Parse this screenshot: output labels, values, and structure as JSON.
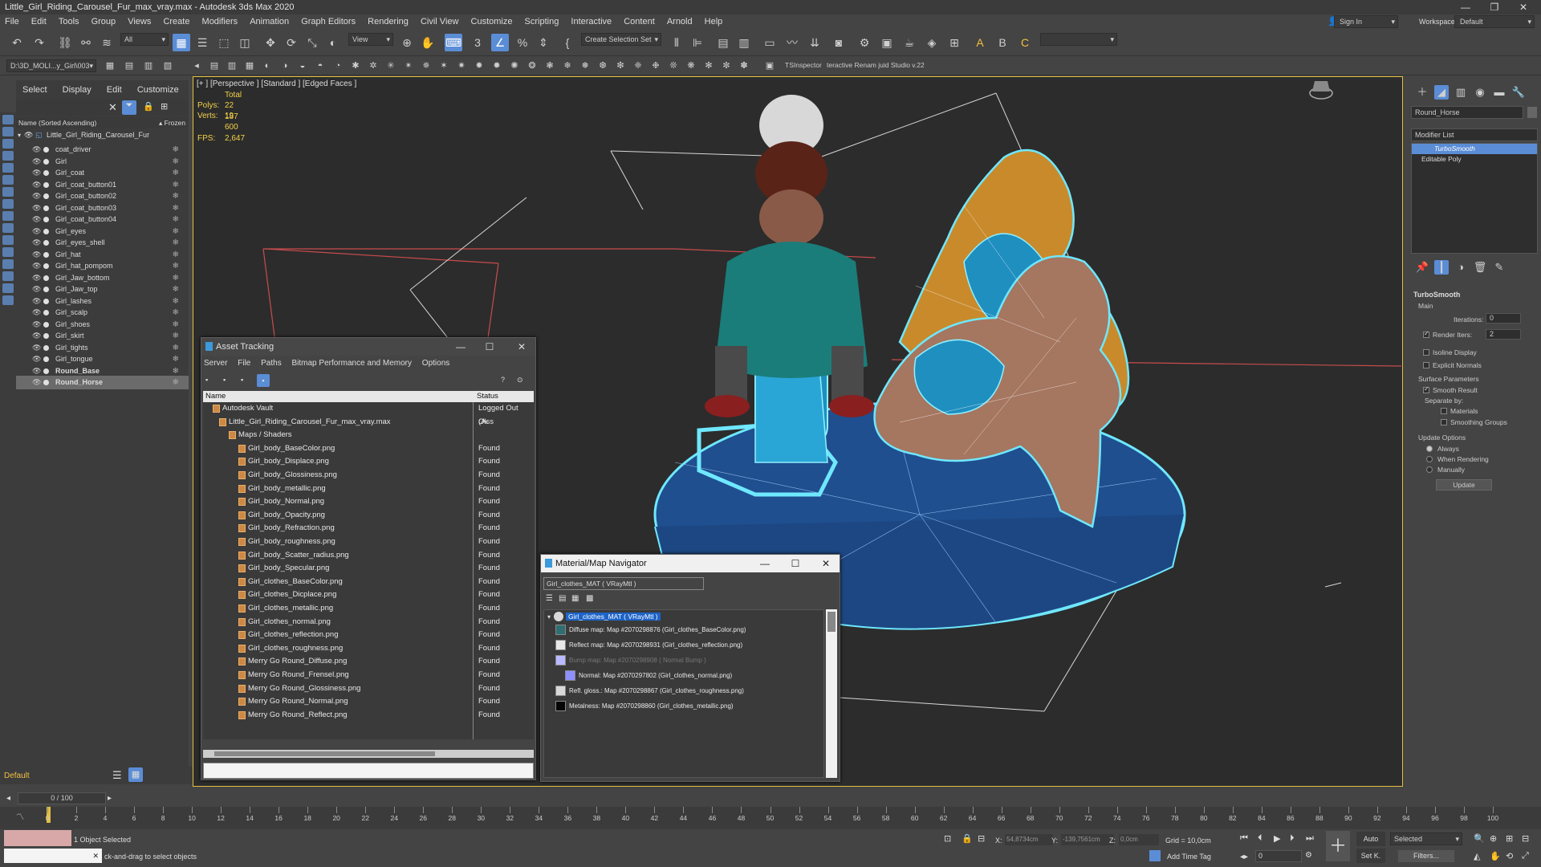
{
  "title": "Little_Girl_Riding_Carousel_Fur_max_vray.max - Autodesk 3ds Max 2020",
  "menu": [
    "File",
    "Edit",
    "Tools",
    "Group",
    "Views",
    "Create",
    "Modifiers",
    "Animation",
    "Graph Editors",
    "Rendering",
    "Civil View",
    "Customize",
    "Scripting",
    "Interactive",
    "Content",
    "Arnold",
    "Help"
  ],
  "signin": "Sign In",
  "workspaces_label": "Workspaces:",
  "workspace_value": "Default",
  "toolbar": {
    "filter_value": "All",
    "view_value": "View",
    "selection_set": "Create Selection Set",
    "project_path": "D:\\3D_MOLI...y_Girl\\003",
    "ts_inspector": "TSInspector",
    "renamer": "teractive Renam juid Studio v.22"
  },
  "scene_explorer": {
    "tabs": [
      "Select",
      "Display",
      "Edit",
      "Customize"
    ],
    "column_name": "Name (Sorted Ascending)",
    "column_frozen": "▴ Frozen",
    "root": "Little_Girl_Riding_Carousel_Fur",
    "items": [
      {
        "name": "coat_driver"
      },
      {
        "name": "Girl"
      },
      {
        "name": "Girl_coat"
      },
      {
        "name": "Girl_coat_button01"
      },
      {
        "name": "Girl_coat_button02"
      },
      {
        "name": "Girl_coat_button03"
      },
      {
        "name": "Girl_coat_button04"
      },
      {
        "name": "Girl_eyes"
      },
      {
        "name": "Girl_eyes_shell"
      },
      {
        "name": "Girl_hat"
      },
      {
        "name": "Girl_hat_pompom"
      },
      {
        "name": "Girl_Jaw_bottom"
      },
      {
        "name": "Girl_Jaw_top"
      },
      {
        "name": "Girl_lashes"
      },
      {
        "name": "Girl_scalp"
      },
      {
        "name": "Girl_shoes"
      },
      {
        "name": "Girl_skirt"
      },
      {
        "name": "Girl_tights"
      },
      {
        "name": "Girl_tongue"
      },
      {
        "name": "Round_Base"
      },
      {
        "name": "Round_Horse"
      }
    ],
    "layer": "Default"
  },
  "viewport": {
    "label": "[+ ] [Perspective ] [Standard ] [Edged Faces ]",
    "total": "Total",
    "polys_label": "Polys:",
    "polys": "22 187",
    "verts_label": "Verts:",
    "verts": "19 600",
    "fps_label": "FPS:",
    "fps": "2,647"
  },
  "asset_tracking": {
    "title": "Asset Tracking",
    "menu": [
      "Server",
      "File",
      "Paths",
      "Bitmap Performance and Memory",
      "Options"
    ],
    "col_name": "Name",
    "col_status": "Status",
    "rows": [
      {
        "name": "Autodesk Vault",
        "status": "Logged Out (Ass",
        "indent": 1
      },
      {
        "name": "Little_Girl_Riding_Carousel_Fur_max_vray.max",
        "status": "Ok",
        "indent": 2
      },
      {
        "name": "Maps / Shaders",
        "status": "",
        "indent": 3
      },
      {
        "name": "Girl_body_BaseColor.png",
        "status": "Found",
        "indent": 4
      },
      {
        "name": "Girl_body_Displace.png",
        "status": "Found",
        "indent": 4
      },
      {
        "name": "Girl_body_Glossiness.png",
        "status": "Found",
        "indent": 4
      },
      {
        "name": "Girl_body_metallic.png",
        "status": "Found",
        "indent": 4
      },
      {
        "name": "Girl_body_Normal.png",
        "status": "Found",
        "indent": 4
      },
      {
        "name": "Girl_body_Opacity.png",
        "status": "Found",
        "indent": 4
      },
      {
        "name": "Girl_body_Refraction.png",
        "status": "Found",
        "indent": 4
      },
      {
        "name": "Girl_body_roughness.png",
        "status": "Found",
        "indent": 4
      },
      {
        "name": "Girl_body_Scatter_radius.png",
        "status": "Found",
        "indent": 4
      },
      {
        "name": "Girl_body_Specular.png",
        "status": "Found",
        "indent": 4
      },
      {
        "name": "Girl_clothes_BaseColor.png",
        "status": "Found",
        "indent": 4
      },
      {
        "name": "Girl_clothes_Dicplace.png",
        "status": "Found",
        "indent": 4
      },
      {
        "name": "Girl_clothes_metallic.png",
        "status": "Found",
        "indent": 4
      },
      {
        "name": "Girl_clothes_normal.png",
        "status": "Found",
        "indent": 4
      },
      {
        "name": "Girl_clothes_reflection.png",
        "status": "Found",
        "indent": 4
      },
      {
        "name": "Girl_clothes_roughness.png",
        "status": "Found",
        "indent": 4
      },
      {
        "name": "Merry Go Round_Diffuse.png",
        "status": "Found",
        "indent": 4
      },
      {
        "name": "Merry Go Round_Frensel.png",
        "status": "Found",
        "indent": 4
      },
      {
        "name": "Merry Go Round_Glossiness.png",
        "status": "Found",
        "indent": 4
      },
      {
        "name": "Merry Go Round_Normal.png",
        "status": "Found",
        "indent": 4
      },
      {
        "name": "Merry Go Round_Reflect.png",
        "status": "Found",
        "indent": 4
      }
    ]
  },
  "material_navigator": {
    "title": "Material/Map Navigator",
    "current": "Girl_clothes_MAT  ( VRayMtl )",
    "root": "Girl_clothes_MAT  ( VRayMtl )",
    "maps": [
      {
        "text": "Diffuse map: Map #2070298876 (Girl_clothes_BaseColor.png)",
        "dim": false,
        "color": "#2f6e72"
      },
      {
        "text": "Reflect map: Map #2070298931 (Girl_clothes_reflection.png)",
        "dim": false,
        "color": "#e8e8e8"
      },
      {
        "text": "Bump map: Map #2070298908  ( Normal Bump )",
        "dim": true,
        "color": "#b9b9ff"
      },
      {
        "text": "Normal: Map #2070297802 (Girl_clothes_normal.png)",
        "dim": false,
        "color": "#8f8fff"
      },
      {
        "text": "Refl. gloss.: Map #2070298867 (Girl_clothes_roughness.png)",
        "dim": false,
        "color": "#d8d8d8"
      },
      {
        "text": "Metalness: Map #2070298860 (Girl_clothes_metallic.png)",
        "dim": false,
        "color": "#050505"
      }
    ]
  },
  "command_panel": {
    "object_name": "Round_Horse",
    "modifier_list": "Modifier List",
    "stack": [
      "TurboSmooth",
      "Editable Poly"
    ],
    "rollout_title": "TurboSmooth",
    "main_label": "Main",
    "iterations_label": "Iterations:",
    "iterations": "0",
    "render_iters_label": "Render Iters:",
    "render_iters": "2",
    "isoline": "Isoline Display",
    "explicit_normals": "Explicit Normals",
    "surface_params": "Surface Parameters",
    "smooth_result": "Smooth Result",
    "separate_by": "Separate by:",
    "materials": "Materials",
    "smoothing_groups": "Smoothing Groups",
    "update_options": "Update Options",
    "always": "Always",
    "when_rendering": "When Rendering",
    "manually": "Manually",
    "update_btn": "Update"
  },
  "timeline": {
    "frame_display": "0 / 100",
    "ticks": [
      0,
      2,
      4,
      6,
      8,
      10,
      12,
      14,
      16,
      18,
      20,
      22,
      24,
      26,
      28,
      30,
      32,
      34,
      36,
      38,
      40,
      42,
      44,
      46,
      48,
      50,
      52,
      54,
      56,
      58,
      60,
      62,
      64,
      66,
      68,
      70,
      72,
      74,
      76,
      78,
      80,
      82,
      84,
      86,
      88,
      90,
      92,
      94,
      96,
      98,
      100
    ]
  },
  "status": {
    "selected": "1 Object Selected",
    "prompt": "ck-and-drag to select objects",
    "x_label": "X:",
    "x": "54,8734cm",
    "y_label": "Y:",
    "y": "-139,7561cm",
    "z_label": "Z:",
    "z": "0,0cm",
    "grid": "Grid = 10,0cm",
    "add_time_tag": "Add Time Tag",
    "auto": "Auto",
    "setk": "Set K.",
    "selected_combo": "Selected",
    "filters": "Filters...",
    "frame": "0"
  }
}
